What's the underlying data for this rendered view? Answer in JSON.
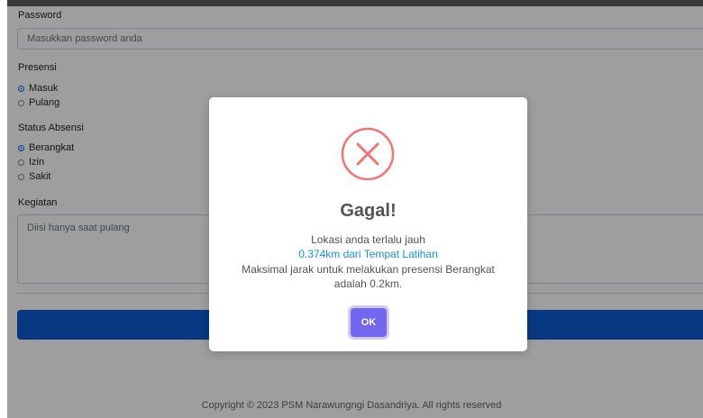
{
  "form": {
    "password_label": "Password",
    "password_placeholder": "Masukkan password anda",
    "presensi_label": "Presensi",
    "presensi_options": [
      {
        "label": "Masuk",
        "selected": true
      },
      {
        "label": "Pulang",
        "selected": false
      }
    ],
    "status_label": "Status Absensi",
    "status_options": [
      {
        "label": "Berangkat",
        "selected": true
      },
      {
        "label": "Izin",
        "selected": false
      },
      {
        "label": "Sakit",
        "selected": false
      }
    ],
    "kegiatan_label": "Kegiatan",
    "kegiatan_placeholder": "Diisi hanya saat pulang"
  },
  "footer": {
    "copyright": "Copyright © 2023 PSM Narawungngi Dasandriya. All rights reserved"
  },
  "modal": {
    "icon": "error-x-icon",
    "title": "Gagal!",
    "line1": "Lokasi anda terlalu jauh",
    "line2": "0.374km dari Tempat Latihan",
    "line3": "Maksimal jarak untuk melakukan presensi Berangkat",
    "line4": "adalah 0.2km.",
    "ok_label": "OK"
  },
  "colors": {
    "primary": "#0d5bd1",
    "error": "#f27474",
    "confirm": "#7367f0",
    "link": "#1e90d9"
  }
}
